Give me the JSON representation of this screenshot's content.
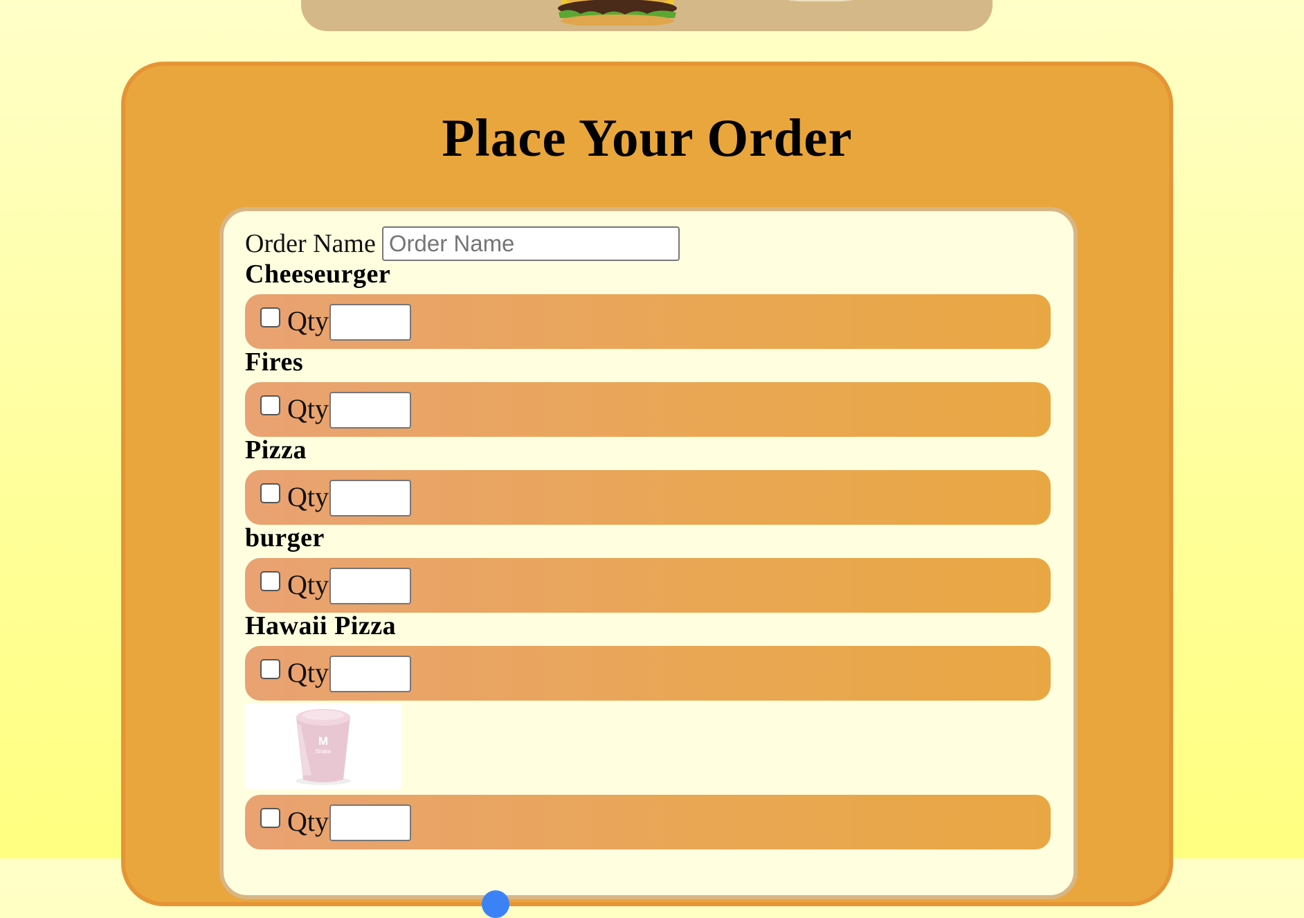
{
  "page": {
    "title": "Place Your Order"
  },
  "order_form": {
    "name_label": "Order Name",
    "name_placeholder": "Order Name",
    "name_value": "",
    "items": [
      {
        "name": "Cheeseurger",
        "qty_label": "Qty",
        "qty_value": "",
        "checked": false
      },
      {
        "name": "Fires",
        "qty_label": "Qty",
        "qty_value": "",
        "checked": false
      },
      {
        "name": "Pizza",
        "qty_label": "Qty",
        "qty_value": "",
        "checked": false
      },
      {
        "name": "burger",
        "qty_label": "Qty",
        "qty_value": "",
        "checked": false
      },
      {
        "name": "Hawaii Pizza",
        "qty_label": "Qty",
        "qty_value": "",
        "checked": false
      },
      {
        "name": "",
        "qty_label": "Qty",
        "qty_value": "",
        "checked": false,
        "image": "milkshake-image"
      }
    ]
  },
  "images": {
    "banner": [
      "cheeseburger-image",
      "wrap-image"
    ],
    "shake_brand_mark": "M",
    "shake_text": "Shake"
  },
  "colors": {
    "page_bg_top": "#ffffc8",
    "page_bg_bottom": "#ffff80",
    "panel_bg": "#e9a63c",
    "panel_border": "#e59535",
    "card_bg": "#ffffe0",
    "card_border": "#d8b584",
    "item_bar_left": "#e9a272",
    "item_bar_right": "#e9a744",
    "banner_bg": "#d5b887",
    "accent_blue": "#3b82f6"
  }
}
